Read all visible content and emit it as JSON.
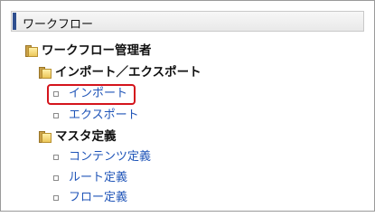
{
  "panel": {
    "title": "ワークフロー"
  },
  "tree": {
    "root": {
      "label": "ワークフロー管理者",
      "icon": "folder-icon"
    },
    "import_export": {
      "label": "インポート／エクスポート",
      "icon": "folder-icon",
      "items": [
        {
          "label": "インポート",
          "selected": true
        },
        {
          "label": "エクスポート",
          "selected": false
        }
      ]
    },
    "master": {
      "label": "マスタ定義",
      "icon": "folder-icon",
      "items": [
        {
          "label": "コンテンツ定義"
        },
        {
          "label": "ルート定義"
        },
        {
          "label": "フロー定義"
        }
      ]
    }
  },
  "colors": {
    "accent": "#2f4f8f",
    "link": "#2055b8",
    "highlight": "#d4141c",
    "folder": "#ecc75a"
  }
}
